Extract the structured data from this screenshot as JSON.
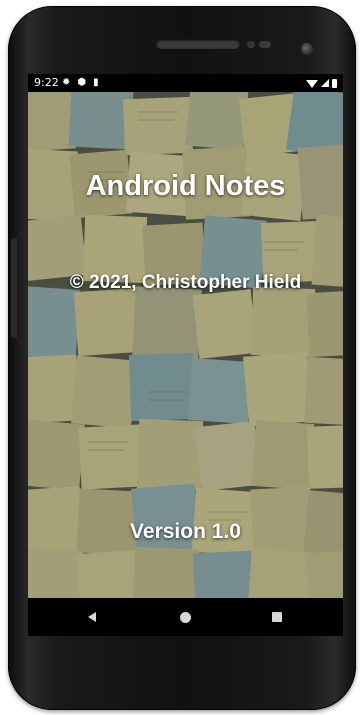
{
  "status_bar": {
    "time": "9:22",
    "left_icons": [
      "gear-icon",
      "shield-icon",
      "sd-card-icon"
    ],
    "right_icons": [
      "wifi-icon",
      "cell-signal-icon",
      "battery-icon"
    ]
  },
  "splash": {
    "app_title": "Android Notes",
    "copyright": "© 2021, Christopher Hield",
    "version": "Version 1.0",
    "background": "sticky-notes-wall-image"
  },
  "nav_bar": {
    "buttons": [
      "back-icon",
      "home-icon",
      "recents-icon"
    ]
  },
  "colors": {
    "note_yellow": "#e6dfa3",
    "note_blue": "#9fc5cc",
    "screen_text": "#ffffff"
  }
}
